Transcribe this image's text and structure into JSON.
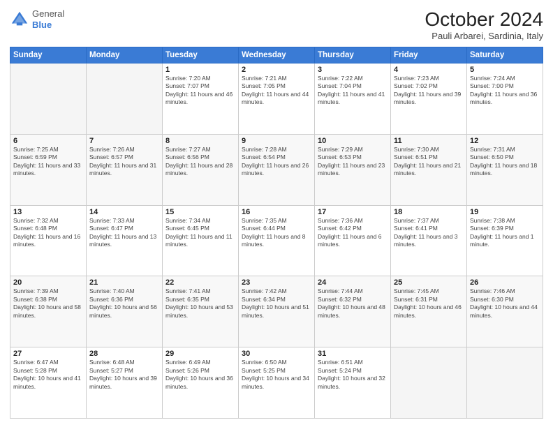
{
  "header": {
    "logo_general": "General",
    "logo_blue": "Blue",
    "title": "October 2024",
    "location": "Pauli Arbarei, Sardinia, Italy"
  },
  "columns": [
    "Sunday",
    "Monday",
    "Tuesday",
    "Wednesday",
    "Thursday",
    "Friday",
    "Saturday"
  ],
  "weeks": [
    [
      {
        "day": "",
        "info": ""
      },
      {
        "day": "",
        "info": ""
      },
      {
        "day": "1",
        "info": "Sunrise: 7:20 AM\nSunset: 7:07 PM\nDaylight: 11 hours and 46 minutes."
      },
      {
        "day": "2",
        "info": "Sunrise: 7:21 AM\nSunset: 7:05 PM\nDaylight: 11 hours and 44 minutes."
      },
      {
        "day": "3",
        "info": "Sunrise: 7:22 AM\nSunset: 7:04 PM\nDaylight: 11 hours and 41 minutes."
      },
      {
        "day": "4",
        "info": "Sunrise: 7:23 AM\nSunset: 7:02 PM\nDaylight: 11 hours and 39 minutes."
      },
      {
        "day": "5",
        "info": "Sunrise: 7:24 AM\nSunset: 7:00 PM\nDaylight: 11 hours and 36 minutes."
      }
    ],
    [
      {
        "day": "6",
        "info": "Sunrise: 7:25 AM\nSunset: 6:59 PM\nDaylight: 11 hours and 33 minutes."
      },
      {
        "day": "7",
        "info": "Sunrise: 7:26 AM\nSunset: 6:57 PM\nDaylight: 11 hours and 31 minutes."
      },
      {
        "day": "8",
        "info": "Sunrise: 7:27 AM\nSunset: 6:56 PM\nDaylight: 11 hours and 28 minutes."
      },
      {
        "day": "9",
        "info": "Sunrise: 7:28 AM\nSunset: 6:54 PM\nDaylight: 11 hours and 26 minutes."
      },
      {
        "day": "10",
        "info": "Sunrise: 7:29 AM\nSunset: 6:53 PM\nDaylight: 11 hours and 23 minutes."
      },
      {
        "day": "11",
        "info": "Sunrise: 7:30 AM\nSunset: 6:51 PM\nDaylight: 11 hours and 21 minutes."
      },
      {
        "day": "12",
        "info": "Sunrise: 7:31 AM\nSunset: 6:50 PM\nDaylight: 11 hours and 18 minutes."
      }
    ],
    [
      {
        "day": "13",
        "info": "Sunrise: 7:32 AM\nSunset: 6:48 PM\nDaylight: 11 hours and 16 minutes."
      },
      {
        "day": "14",
        "info": "Sunrise: 7:33 AM\nSunset: 6:47 PM\nDaylight: 11 hours and 13 minutes."
      },
      {
        "day": "15",
        "info": "Sunrise: 7:34 AM\nSunset: 6:45 PM\nDaylight: 11 hours and 11 minutes."
      },
      {
        "day": "16",
        "info": "Sunrise: 7:35 AM\nSunset: 6:44 PM\nDaylight: 11 hours and 8 minutes."
      },
      {
        "day": "17",
        "info": "Sunrise: 7:36 AM\nSunset: 6:42 PM\nDaylight: 11 hours and 6 minutes."
      },
      {
        "day": "18",
        "info": "Sunrise: 7:37 AM\nSunset: 6:41 PM\nDaylight: 11 hours and 3 minutes."
      },
      {
        "day": "19",
        "info": "Sunrise: 7:38 AM\nSunset: 6:39 PM\nDaylight: 11 hours and 1 minute."
      }
    ],
    [
      {
        "day": "20",
        "info": "Sunrise: 7:39 AM\nSunset: 6:38 PM\nDaylight: 10 hours and 58 minutes."
      },
      {
        "day": "21",
        "info": "Sunrise: 7:40 AM\nSunset: 6:36 PM\nDaylight: 10 hours and 56 minutes."
      },
      {
        "day": "22",
        "info": "Sunrise: 7:41 AM\nSunset: 6:35 PM\nDaylight: 10 hours and 53 minutes."
      },
      {
        "day": "23",
        "info": "Sunrise: 7:42 AM\nSunset: 6:34 PM\nDaylight: 10 hours and 51 minutes."
      },
      {
        "day": "24",
        "info": "Sunrise: 7:44 AM\nSunset: 6:32 PM\nDaylight: 10 hours and 48 minutes."
      },
      {
        "day": "25",
        "info": "Sunrise: 7:45 AM\nSunset: 6:31 PM\nDaylight: 10 hours and 46 minutes."
      },
      {
        "day": "26",
        "info": "Sunrise: 7:46 AM\nSunset: 6:30 PM\nDaylight: 10 hours and 44 minutes."
      }
    ],
    [
      {
        "day": "27",
        "info": "Sunrise: 6:47 AM\nSunset: 5:28 PM\nDaylight: 10 hours and 41 minutes."
      },
      {
        "day": "28",
        "info": "Sunrise: 6:48 AM\nSunset: 5:27 PM\nDaylight: 10 hours and 39 minutes."
      },
      {
        "day": "29",
        "info": "Sunrise: 6:49 AM\nSunset: 5:26 PM\nDaylight: 10 hours and 36 minutes."
      },
      {
        "day": "30",
        "info": "Sunrise: 6:50 AM\nSunset: 5:25 PM\nDaylight: 10 hours and 34 minutes."
      },
      {
        "day": "31",
        "info": "Sunrise: 6:51 AM\nSunset: 5:24 PM\nDaylight: 10 hours and 32 minutes."
      },
      {
        "day": "",
        "info": ""
      },
      {
        "day": "",
        "info": ""
      }
    ]
  ]
}
